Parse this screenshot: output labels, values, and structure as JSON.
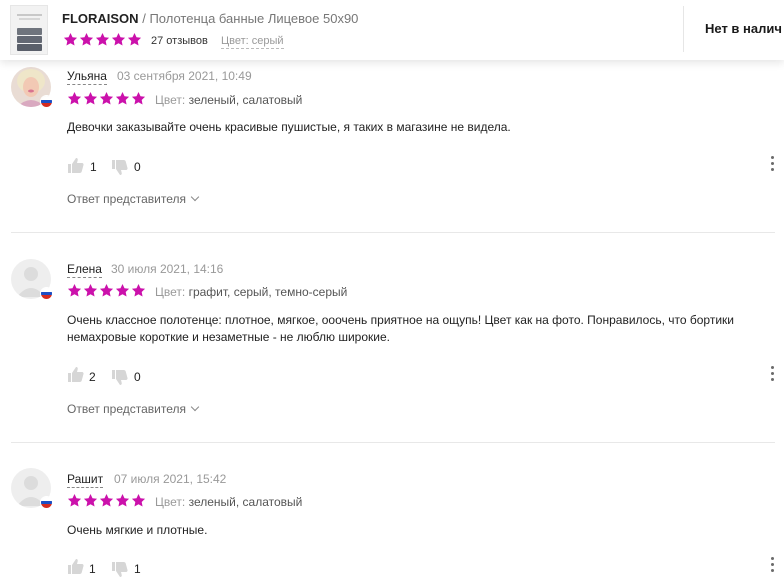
{
  "header": {
    "brand": "FLORAISON",
    "separator": "/",
    "product_name": "Полотенца банные Лицевое 50х90",
    "reviews_count": "27 отзывов",
    "color_label": "Цвет: серый",
    "availability": "Нет в налич",
    "rating": 5
  },
  "reviews": [
    {
      "author": "Ульяна",
      "date": "03 сентября 2021, 10:49",
      "rating": 5,
      "color_label": "Цвет:",
      "color_value": "зеленый, салатовый",
      "text": "Девочки заказывайте очень красивые пушистые, я таких в магазине не видела.",
      "likes": "1",
      "dislikes": "0",
      "reply": "Ответ представителя",
      "avatar": "photo"
    },
    {
      "author": "Елена",
      "date": "30 июля 2021, 14:16",
      "rating": 5,
      "color_label": "Цвет:",
      "color_value": "графит, серый, темно-серый",
      "text": "Очень классное полотенце: плотное, мягкое, ооочень приятное на ощупь! Цвет как на фото. Понравилось, что бортики немахровые короткие и незаметные - не люблю широкие.",
      "likes": "2",
      "dislikes": "0",
      "reply": "Ответ представителя",
      "avatar": "placeholder"
    },
    {
      "author": "Рашит",
      "date": "07 июля 2021, 15:42",
      "rating": 5,
      "color_label": "Цвет:",
      "color_value": "зеленый, салатовый",
      "text": "Очень мягкие и плотные.",
      "likes": "1",
      "dislikes": "1",
      "avatar": "placeholder"
    }
  ],
  "colors": {
    "star": "#cb11ab",
    "flag": [
      "#ffffff",
      "#1c4fc4",
      "#d52b1e"
    ]
  }
}
